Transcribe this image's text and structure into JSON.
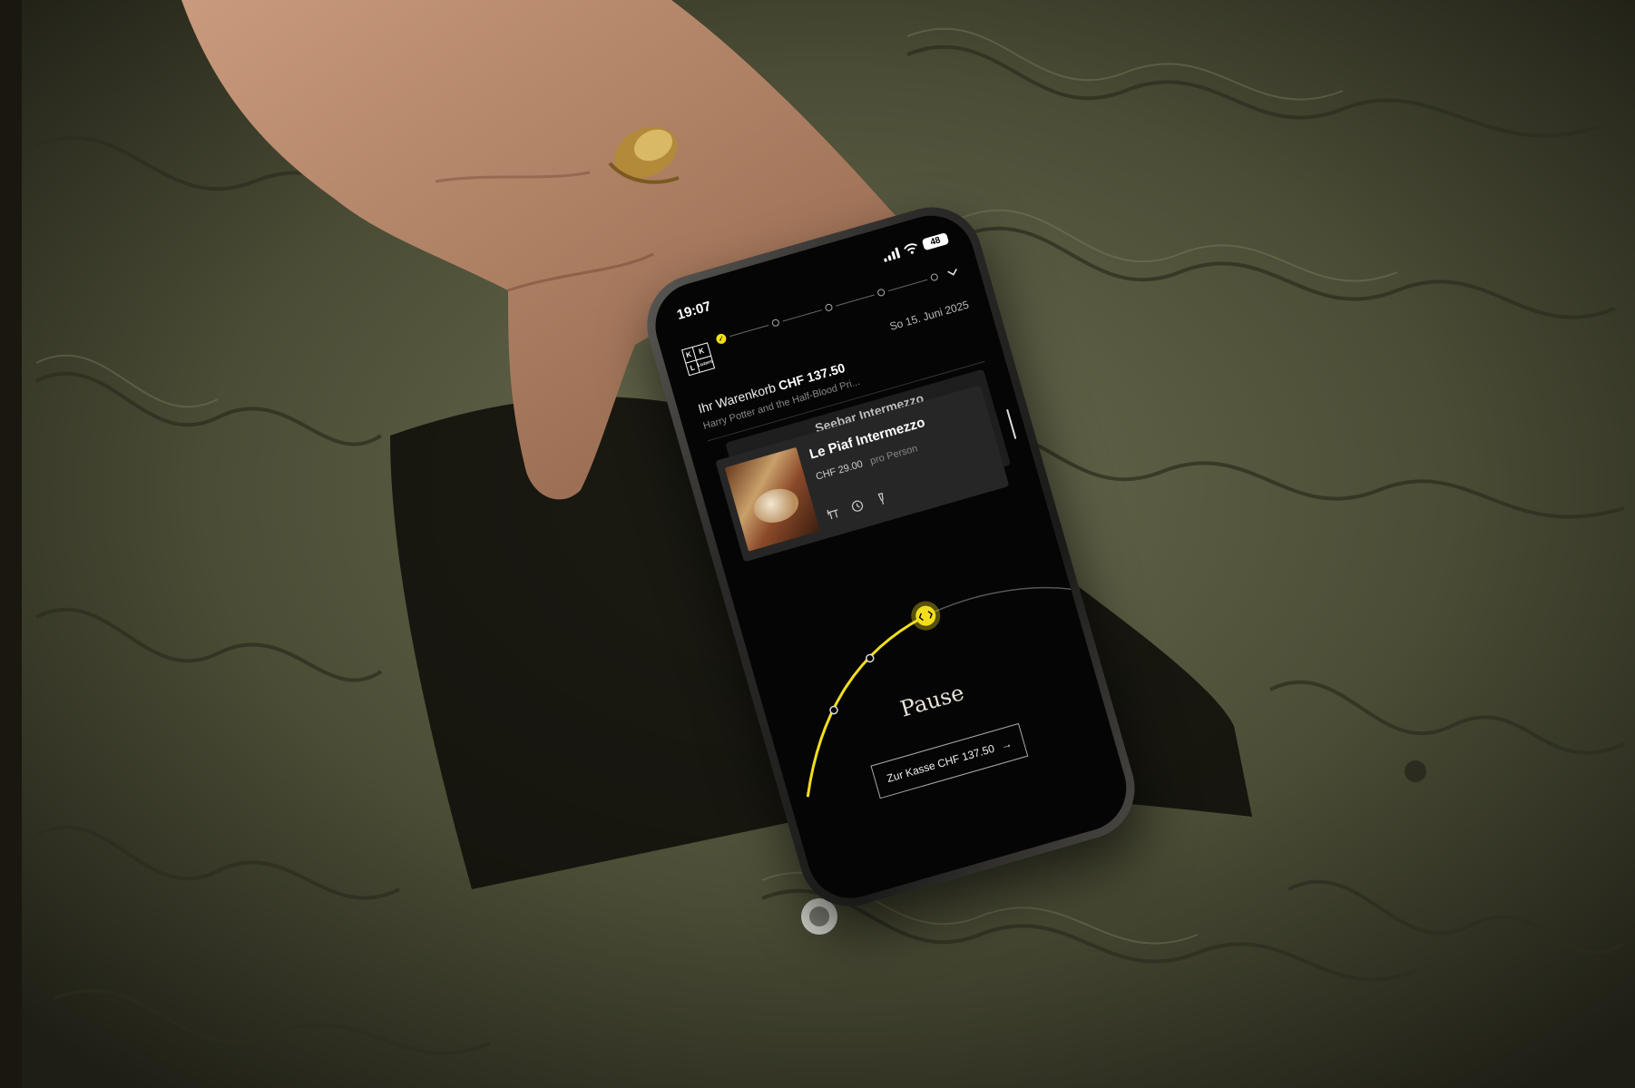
{
  "status_bar": {
    "time": "19:07",
    "battery": "48"
  },
  "header": {
    "logo_letters": [
      "K",
      "K",
      "L",
      "Luzern"
    ],
    "date": "So 15. Juni 2025"
  },
  "cart": {
    "label": "Ihr Warenkorb",
    "total": "CHF 137.50",
    "event": "Harry Potter and the Half-Blood Pri..."
  },
  "offers": [
    {
      "title": "Seebar Intermezzo"
    },
    {
      "title": "Le Piaf Intermezzo",
      "price": "CHF 29.00",
      "unit": "pro Person",
      "icons": [
        "table-icon",
        "clock-icon",
        "drink-icon"
      ]
    }
  ],
  "timeline": {
    "label": "Pause"
  },
  "checkout": {
    "label": "Zur Kasse CHF 137.50",
    "arrow": "→"
  },
  "colors": {
    "accent": "#f2de1c",
    "screen_bg": "#050505",
    "jacket": "#4e5038"
  }
}
